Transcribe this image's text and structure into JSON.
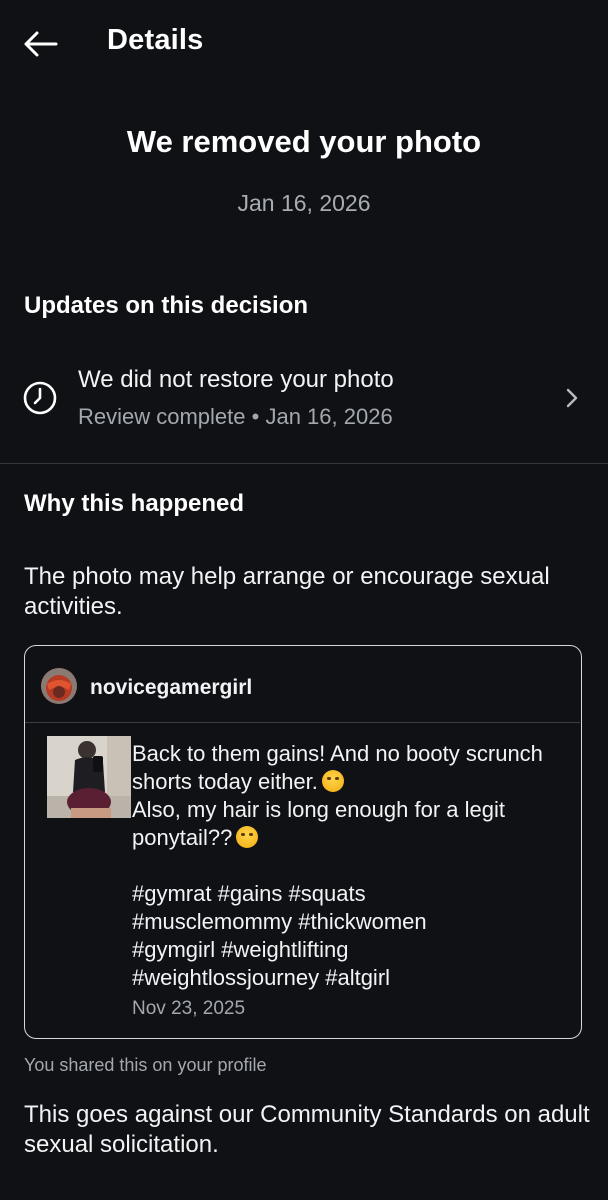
{
  "header": {
    "title": "Details",
    "back_icon": "arrow-left-icon"
  },
  "notice": {
    "headline": "We removed your photo",
    "date": "Jan 16, 2026"
  },
  "updates": {
    "heading": "Updates on this decision",
    "item": {
      "title": "We did not restore your photo",
      "status": "Review complete",
      "separator": "•",
      "date": "Jan 16, 2026",
      "icon": "clock-icon"
    }
  },
  "why": {
    "heading": "Why this happened",
    "text": "The photo may help arrange or encourage sexual activities."
  },
  "post": {
    "username": "novicegamergirl",
    "caption_line1": "Back to them gains! And no booty scrunch shorts today either.",
    "caption_line2": "Also, my hair is long enough for a legit ponytail??",
    "hashtags": "#gymrat #gains #squats\n#musclemommy #thickwomen\n#gymgirl #weightlifting\n#weightlossjourney #altgirl",
    "date": "Nov 23, 2025"
  },
  "shared_note": "You shared this on your profile",
  "standards_text": "This goes against our Community Standards on adult sexual solicitation."
}
